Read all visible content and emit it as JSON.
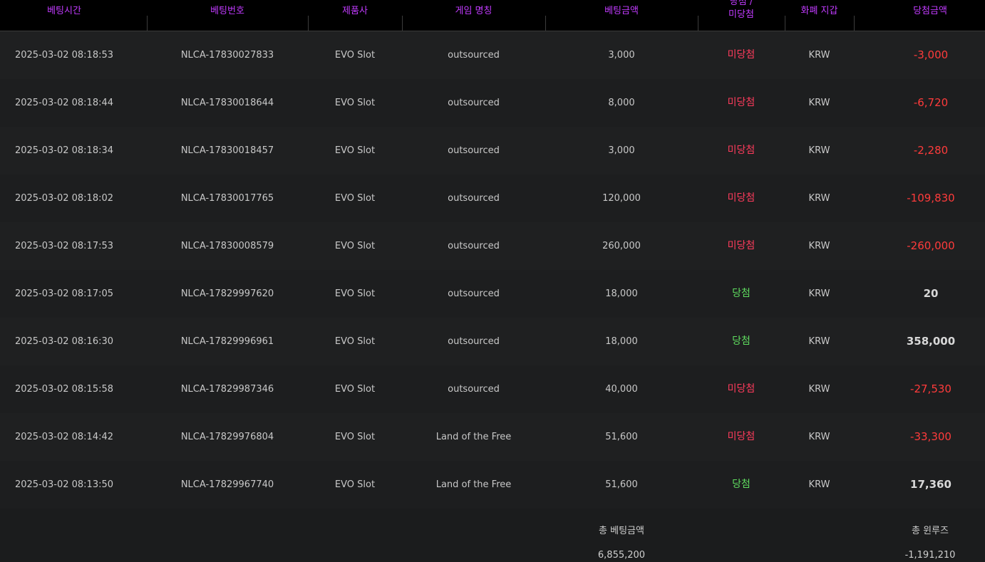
{
  "headers": {
    "bet_time": "베팅시간",
    "bet_no": "베팅번호",
    "provider": "제품사",
    "game": "게임 명칭",
    "amount": "베팅금액",
    "result_line1": "당첨 /",
    "result_line2": "미당첨",
    "currency": "화폐 지갑",
    "win_amount": "당첨금액"
  },
  "colors": {
    "header_text": "#c23bff",
    "lose": "#ff3b5c",
    "win": "#5fdc5f",
    "negative_amount": "#ff3b3b"
  },
  "rows": [
    {
      "time": "2025-03-02 08:18:53",
      "no": "NLCA-17830027833",
      "provider": "EVO Slot",
      "game": "outsourced",
      "amount": "3,000",
      "result": "미당첨",
      "win": false,
      "currency": "KRW",
      "payout": "-3,000"
    },
    {
      "time": "2025-03-02 08:18:44",
      "no": "NLCA-17830018644",
      "provider": "EVO Slot",
      "game": "outsourced",
      "amount": "8,000",
      "result": "미당첨",
      "win": false,
      "currency": "KRW",
      "payout": "-6,720"
    },
    {
      "time": "2025-03-02 08:18:34",
      "no": "NLCA-17830018457",
      "provider": "EVO Slot",
      "game": "outsourced",
      "amount": "3,000",
      "result": "미당첨",
      "win": false,
      "currency": "KRW",
      "payout": "-2,280"
    },
    {
      "time": "2025-03-02 08:18:02",
      "no": "NLCA-17830017765",
      "provider": "EVO Slot",
      "game": "outsourced",
      "amount": "120,000",
      "result": "미당첨",
      "win": false,
      "currency": "KRW",
      "payout": "-109,830"
    },
    {
      "time": "2025-03-02 08:17:53",
      "no": "NLCA-17830008579",
      "provider": "EVO Slot",
      "game": "outsourced",
      "amount": "260,000",
      "result": "미당첨",
      "win": false,
      "currency": "KRW",
      "payout": "-260,000"
    },
    {
      "time": "2025-03-02 08:17:05",
      "no": "NLCA-17829997620",
      "provider": "EVO Slot",
      "game": "outsourced",
      "amount": "18,000",
      "result": "당첨",
      "win": true,
      "currency": "KRW",
      "payout": "20"
    },
    {
      "time": "2025-03-02 08:16:30",
      "no": "NLCA-17829996961",
      "provider": "EVO Slot",
      "game": "outsourced",
      "amount": "18,000",
      "result": "당첨",
      "win": true,
      "currency": "KRW",
      "payout": "358,000"
    },
    {
      "time": "2025-03-02 08:15:58",
      "no": "NLCA-17829987346",
      "provider": "EVO Slot",
      "game": "outsourced",
      "amount": "40,000",
      "result": "미당첨",
      "win": false,
      "currency": "KRW",
      "payout": "-27,530"
    },
    {
      "time": "2025-03-02 08:14:42",
      "no": "NLCA-17829976804",
      "provider": "EVO Slot",
      "game": "Land of the Free",
      "amount": "51,600",
      "result": "미당첨",
      "win": false,
      "currency": "KRW",
      "payout": "-33,300"
    },
    {
      "time": "2025-03-02 08:13:50",
      "no": "NLCA-17829967740",
      "provider": "EVO Slot",
      "game": "Land of the Free",
      "amount": "51,600",
      "result": "당첨",
      "win": true,
      "currency": "KRW",
      "payout": "17,360"
    }
  ],
  "totals": {
    "bet_label": "총 베팅금액",
    "bet_value": "6,855,200",
    "winloss_label": "총 윈루즈",
    "winloss_value": "-1,191,210"
  }
}
